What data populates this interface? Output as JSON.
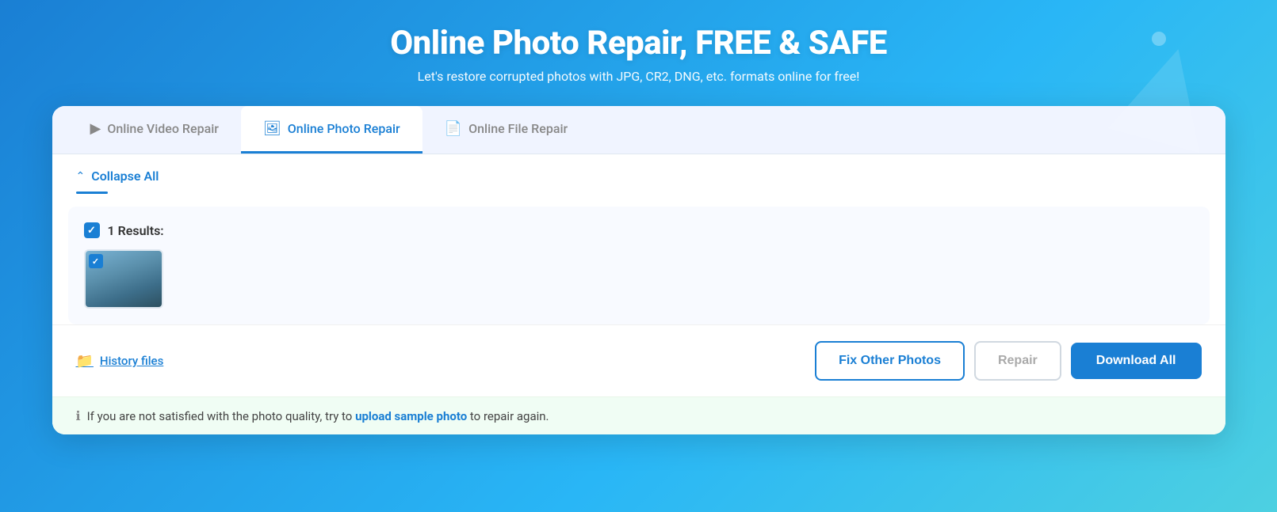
{
  "header": {
    "title": "Online Photo Repair, FREE & SAFE",
    "subtitle": "Let's restore corrupted photos with JPG, CR2, DNG, etc. formats online for free!"
  },
  "tabs": [
    {
      "id": "video",
      "label": "Online Video Repair",
      "icon": "▶",
      "active": false
    },
    {
      "id": "photo",
      "label": "Online Photo Repair",
      "icon": "🖼",
      "active": true
    },
    {
      "id": "file",
      "label": "Online File Repair",
      "icon": "📄",
      "active": false
    }
  ],
  "collapse": {
    "label": "Collapse All"
  },
  "results": {
    "count_label": "1 Results:"
  },
  "bottom_bar": {
    "history_label": "History files",
    "btn_fix_other": "Fix Other Photos",
    "btn_repair": "Repair",
    "btn_download_all": "Download All"
  },
  "info_bar": {
    "text_prefix": "If you are not satisfied with the photo quality, try to",
    "link_text": "upload sample photo",
    "text_suffix": "to repair again."
  }
}
